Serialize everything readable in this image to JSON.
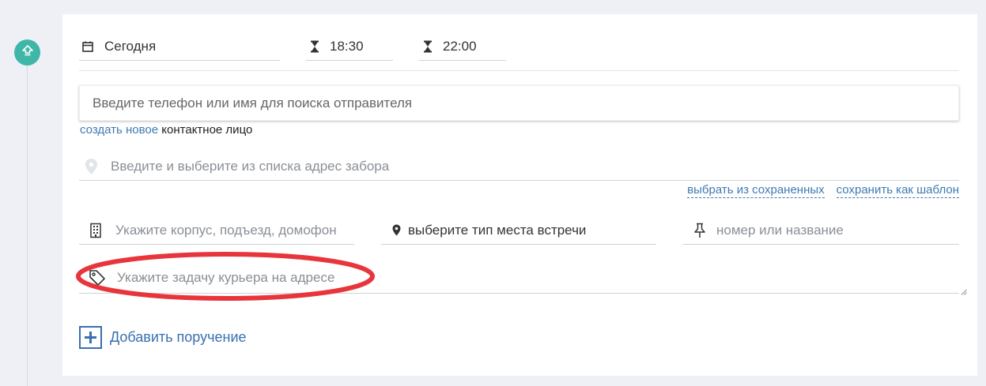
{
  "timeline": {
    "step_icon": "upload-arrow-icon",
    "step_color": "#3fb7a8"
  },
  "schedule": {
    "date": {
      "icon": "calendar-icon",
      "value": "Сегодня"
    },
    "time_from": {
      "icon": "hourglass-icon",
      "value": "18:30"
    },
    "time_to": {
      "icon": "hourglass-icon",
      "value": "22:00"
    }
  },
  "sender": {
    "search_placeholder": "Введите телефон или имя для поиска отправителя",
    "create_link": "создать новое",
    "create_suffix": "контактное лицо"
  },
  "address": {
    "icon": "map-pin-icon",
    "placeholder": "Введите и выберите из списка адрес забора",
    "choose_saved": "выбрать из сохраненных",
    "save_template": "сохранить как шаблон"
  },
  "details": {
    "building": {
      "icon": "building-icon",
      "placeholder": "Укажите корпус, подъезд, домофон"
    },
    "meeting_place": {
      "icon": "location-marker-icon",
      "value": "выберите тип места встречи"
    },
    "number": {
      "icon": "pushpin-icon",
      "placeholder": "номер или название"
    }
  },
  "task": {
    "icon": "tag-icon",
    "placeholder": "Укажите задачу курьера на адресе"
  },
  "add_order": {
    "icon": "plus-square-icon",
    "label": "Добавить поручение"
  },
  "colors": {
    "accent": "#3e7ab5",
    "highlight": "#e8353c"
  }
}
